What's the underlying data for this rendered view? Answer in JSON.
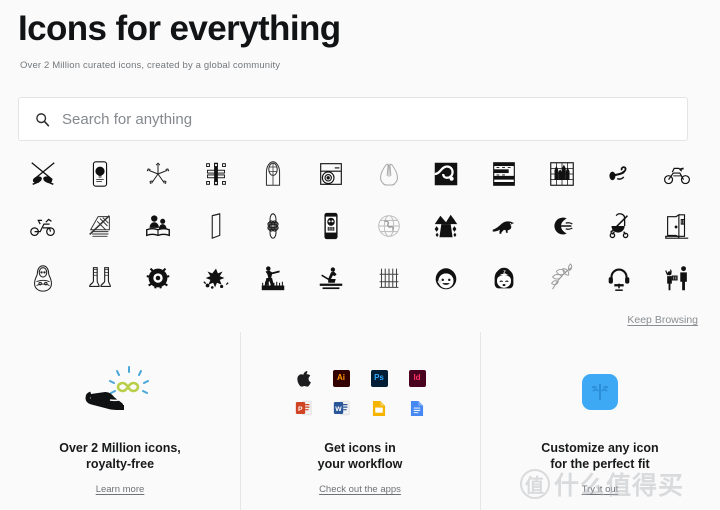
{
  "header": {
    "title": "Icons for everything",
    "subtitle": "Over 2 Million curated icons, created by a global community"
  },
  "search": {
    "placeholder": "Search for anything",
    "value": "",
    "icon": "search-icon"
  },
  "icon_grid": {
    "columns": 12,
    "rows": 3,
    "items": [
      {
        "name": "crossed-fencing-swords-icon"
      },
      {
        "name": "smartphone-lightbulb-idea-icon"
      },
      {
        "name": "starfish-sketch-icon"
      },
      {
        "name": "pencil-design-artboard-icon"
      },
      {
        "name": "gothic-arch-window-icon"
      },
      {
        "name": "vinyl-record-player-icon"
      },
      {
        "name": "praying-hands-icon"
      },
      {
        "name": "winding-road-path-icon"
      },
      {
        "name": "layered-film-strip-icon"
      },
      {
        "name": "city-skyline-grid-icon"
      },
      {
        "name": "whistle-blowing-icon"
      },
      {
        "name": "sport-motorcycle-icon"
      },
      {
        "name": "scooter-motorbike-icon"
      },
      {
        "name": "crossed-out-poster-icon"
      },
      {
        "name": "parents-reading-book-icon"
      },
      {
        "name": "smartphone-outline-icon"
      },
      {
        "name": "flower-blossom-icon"
      },
      {
        "name": "phone-skull-alert-icon"
      },
      {
        "name": "globe-earth-sketch-icon"
      },
      {
        "name": "mountain-waterfall-icon"
      },
      {
        "name": "dinosaur-raptor-icon"
      },
      {
        "name": "crescent-swirl-icon"
      },
      {
        "name": "no-stroller-icon"
      },
      {
        "name": "open-door-exit-icon"
      },
      {
        "name": "matryoshka-doll-icon"
      },
      {
        "name": "boots-footwear-icon"
      },
      {
        "name": "bug-beetle-icon"
      },
      {
        "name": "fireworks-burst-icon"
      },
      {
        "name": "hunter-field-icon"
      },
      {
        "name": "rowing-boat-icon"
      },
      {
        "name": "garden-fence-icon"
      },
      {
        "name": "smiling-boy-face-icon"
      },
      {
        "name": "sleeping-girl-face-icon"
      },
      {
        "name": "leaf-branch-icon"
      },
      {
        "name": "headphones-stand-icon"
      },
      {
        "name": "adult-child-gift-icon"
      }
    ]
  },
  "keep_browsing": {
    "label": "Keep Browsing"
  },
  "cards": [
    {
      "id": "royalty-free",
      "art": "hand-infinity-icon",
      "title_line1": "Over 2 Million icons,",
      "title_line2": "royalty-free",
      "link": "Learn more"
    },
    {
      "id": "workflow",
      "art": "app-icons-grid",
      "title_line1": "Get icons in",
      "title_line2": "your workflow",
      "link": "Check out the apps",
      "apps": [
        {
          "name": "apple-icon",
          "label": "",
          "bg": "transparent",
          "fg": "#1d1d1f"
        },
        {
          "name": "illustrator-icon",
          "label": "Ai",
          "bg": "#330000",
          "fg": "#ff9a00"
        },
        {
          "name": "photoshop-icon",
          "label": "Ps",
          "bg": "#001e36",
          "fg": "#31a8ff"
        },
        {
          "name": "indesign-icon",
          "label": "Id",
          "bg": "#49021f",
          "fg": "#ff3366"
        },
        {
          "name": "powerpoint-icon",
          "label": "P",
          "bg": "#d04423",
          "fg": "#ffffff"
        },
        {
          "name": "word-icon",
          "label": "W",
          "bg": "#2b579a",
          "fg": "#ffffff"
        },
        {
          "name": "google-slides-icon",
          "label": "",
          "bg": "#f4b400",
          "fg": "#ffffff"
        },
        {
          "name": "google-docs-icon",
          "label": "",
          "bg": "#4688f1",
          "fg": "#ffffff"
        }
      ]
    },
    {
      "id": "customize",
      "art": "blue-face-app-icon",
      "title_line1": "Customize any icon",
      "title_line2": "for the perfect fit",
      "link": "Try it out",
      "art_color": "#3da9f5"
    }
  ],
  "watermark": {
    "badge": "值",
    "text": "什么值得买"
  },
  "colors": {
    "page_bg": "#fafafa",
    "search_bg": "#ffffff",
    "border": "#e2e4e6",
    "text_primary": "#17191b",
    "text_muted": "#74787c",
    "divider": "#e4e6e8"
  }
}
